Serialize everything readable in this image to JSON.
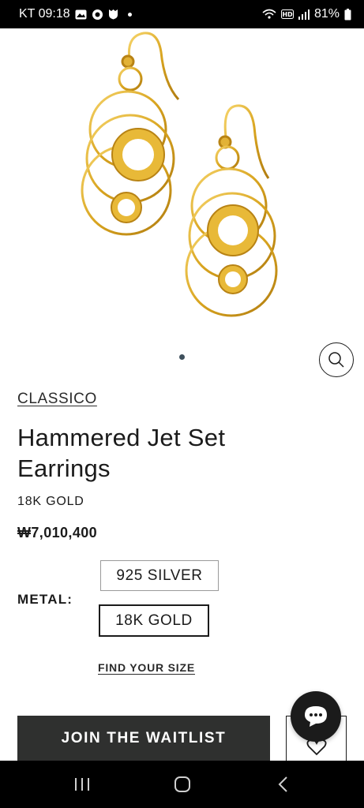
{
  "status_bar": {
    "carrier_time": "KT 09:18",
    "battery": "81%",
    "icons": [
      "gallery-icon",
      "sync-icon",
      "shield-icon",
      "wifi-calling-icon",
      "hd-icon",
      "signal-icon",
      "battery-icon"
    ]
  },
  "product": {
    "collection": "CLASSICO",
    "title": "Hammered Jet Set Earrings",
    "material": "18K GOLD",
    "price": "₩7,010,400",
    "carousel": {
      "total_slides": 1,
      "active_slide": 1
    }
  },
  "metal_selector": {
    "label": "METAL:",
    "options": [
      {
        "label": "925 SILVER",
        "selected": false
      },
      {
        "label": "18K GOLD",
        "selected": true
      }
    ]
  },
  "links": {
    "find_size": "FIND YOUR SIZE"
  },
  "actions": {
    "waitlist_label": "JOIN THE WAITLIST"
  },
  "colors": {
    "button_dark": "#2f302f",
    "gold": "#d9a520",
    "dot": "#3e4f5c"
  }
}
